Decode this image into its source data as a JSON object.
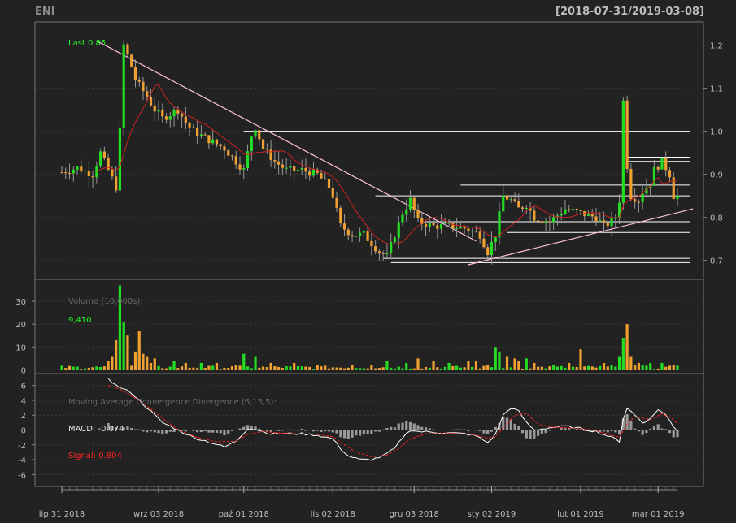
{
  "header": {
    "symbol": "ENI",
    "range": "[2018-07-31/2019-03-08]"
  },
  "colors": {
    "background": "#222222",
    "panel_border": "#777777",
    "grid": "#3a3a3a",
    "text": "#bdbdbd",
    "up": "#22dd22",
    "down": "#f0a030",
    "wick": "#999999",
    "ma": "#cc2222",
    "hline": "#ffffff",
    "trendline": "#ffc0e0",
    "macd_line": "#ffffff",
    "signal_line": "#ff2222",
    "histogram": "#999999",
    "last_label": "#22ff22",
    "signal_label": "#ff2222"
  },
  "chart_data": [
    {
      "type": "candlestick",
      "panel": "price",
      "label": "Last 0.85",
      "ylim": [
        0.68,
        1.23
      ],
      "yticks": [
        0.7,
        0.8,
        0.9,
        1.0,
        1.1,
        1.2
      ],
      "ytick_labels": [
        "0.7",
        "0.8",
        "0.9",
        "1.0",
        "1.1",
        "1.2"
      ],
      "xticks": [
        {
          "index": 0,
          "label": "lip 31 2018"
        },
        {
          "index": 25,
          "label": "wrz 03 2018"
        },
        {
          "index": 47,
          "label": "paź 01 2018"
        },
        {
          "index": 70,
          "label": "lis 02 2018"
        },
        {
          "index": 91,
          "label": "gru 03 2018"
        },
        {
          "index": 111,
          "label": "sty 02 2019"
        },
        {
          "index": 134,
          "label": "lut 01 2019"
        },
        {
          "index": 154,
          "label": "mar 01 2019"
        }
      ],
      "n_bars": 160,
      "anchors": [
        [
          0,
          0.905
        ],
        [
          4,
          0.915
        ],
        [
          8,
          0.9
        ],
        [
          10,
          0.95
        ],
        [
          12,
          0.91
        ],
        [
          14,
          0.87
        ],
        [
          15,
          1.0
        ],
        [
          16,
          1.2
        ],
        [
          18,
          1.15
        ],
        [
          19,
          1.12
        ],
        [
          22,
          1.08
        ],
        [
          24,
          1.05
        ],
        [
          26,
          1.03
        ],
        [
          30,
          1.05
        ],
        [
          32,
          1.02
        ],
        [
          34,
          1.0
        ],
        [
          38,
          0.98
        ],
        [
          42,
          0.96
        ],
        [
          45,
          0.93
        ],
        [
          47,
          0.91
        ],
        [
          49,
          0.99
        ],
        [
          50,
          1.01
        ],
        [
          52,
          0.96
        ],
        [
          55,
          0.93
        ],
        [
          58,
          0.91
        ],
        [
          62,
          0.91
        ],
        [
          66,
          0.9
        ],
        [
          69,
          0.87
        ],
        [
          70,
          0.85
        ],
        [
          72,
          0.78
        ],
        [
          75,
          0.76
        ],
        [
          78,
          0.76
        ],
        [
          80,
          0.74
        ],
        [
          82,
          0.72
        ],
        [
          84,
          0.71
        ],
        [
          86,
          0.76
        ],
        [
          88,
          0.81
        ],
        [
          90,
          0.84
        ],
        [
          92,
          0.79
        ],
        [
          96,
          0.78
        ],
        [
          100,
          0.78
        ],
        [
          104,
          0.775
        ],
        [
          108,
          0.76
        ],
        [
          110,
          0.72
        ],
        [
          111,
          0.74
        ],
        [
          112,
          0.76
        ],
        [
          114,
          0.85
        ],
        [
          116,
          0.84
        ],
        [
          118,
          0.82
        ],
        [
          120,
          0.83
        ],
        [
          122,
          0.8
        ],
        [
          126,
          0.79
        ],
        [
          130,
          0.82
        ],
        [
          134,
          0.81
        ],
        [
          138,
          0.8
        ],
        [
          140,
          0.78
        ],
        [
          142,
          0.79
        ],
        [
          143,
          0.8
        ],
        [
          144,
          0.84
        ],
        [
          145,
          1.07
        ],
        [
          146,
          0.92
        ],
        [
          147,
          0.85
        ],
        [
          149,
          0.84
        ],
        [
          150,
          0.86
        ],
        [
          152,
          0.88
        ],
        [
          153,
          0.91
        ],
        [
          155,
          0.93
        ],
        [
          157,
          0.9
        ],
        [
          158,
          0.85
        ],
        [
          159,
          0.85
        ]
      ],
      "horizontal_levels": [
        {
          "value": 1.0,
          "from_index": 47,
          "to_index": 159
        },
        {
          "value": 0.94,
          "from_index": 146,
          "to_index": 159
        },
        {
          "value": 0.93,
          "from_index": 146,
          "to_index": 159
        },
        {
          "value": 0.875,
          "from_index": 103,
          "to_index": 159
        },
        {
          "value": 0.85,
          "from_index": 81,
          "to_index": 159
        },
        {
          "value": 0.79,
          "from_index": 93,
          "to_index": 159
        },
        {
          "value": 0.765,
          "from_index": 115,
          "to_index": 159
        },
        {
          "value": 0.705,
          "from_index": 83,
          "to_index": 159
        },
        {
          "value": 0.695,
          "from_index": 85,
          "to_index": 159
        }
      ],
      "trendlines": [
        {
          "from": [
            9,
            1.21
          ],
          "to": [
            107,
            0.745
          ]
        },
        {
          "from": [
            105,
            0.69
          ],
          "to": [
            163,
            0.82
          ]
        }
      ]
    },
    {
      "type": "bar",
      "panel": "volume",
      "label": "Volume (10,000s):",
      "last_value_label": "9,410",
      "ylim": [
        0,
        38
      ],
      "yticks": [
        0,
        10,
        20,
        30
      ],
      "ytick_labels": [
        "0",
        "10",
        "20",
        "30"
      ],
      "spikes": [
        [
          12,
          4
        ],
        [
          13,
          6
        ],
        [
          14,
          13
        ],
        [
          15,
          37
        ],
        [
          16,
          21
        ],
        [
          17,
          15
        ],
        [
          19,
          8
        ],
        [
          20,
          17
        ],
        [
          21,
          7
        ],
        [
          22,
          6
        ],
        [
          23,
          3
        ],
        [
          24,
          5
        ],
        [
          29,
          4
        ],
        [
          32,
          3
        ],
        [
          36,
          3
        ],
        [
          40,
          3
        ],
        [
          45,
          2
        ],
        [
          47,
          7
        ],
        [
          50,
          6
        ],
        [
          54,
          3
        ],
        [
          60,
          3
        ],
        [
          66,
          2
        ],
        [
          75,
          2
        ],
        [
          80,
          2
        ],
        [
          84,
          4
        ],
        [
          89,
          3
        ],
        [
          92,
          5
        ],
        [
          96,
          4
        ],
        [
          100,
          3
        ],
        [
          105,
          4
        ],
        [
          107,
          4
        ],
        [
          110,
          2
        ],
        [
          112,
          10
        ],
        [
          113,
          8
        ],
        [
          115,
          6
        ],
        [
          117,
          5
        ],
        [
          118,
          4
        ],
        [
          120,
          5
        ],
        [
          122,
          3
        ],
        [
          127,
          2
        ],
        [
          131,
          3
        ],
        [
          134,
          9
        ],
        [
          140,
          3
        ],
        [
          142,
          2
        ],
        [
          144,
          6
        ],
        [
          145,
          14
        ],
        [
          146,
          20
        ],
        [
          147,
          6
        ],
        [
          148,
          2
        ],
        [
          149,
          3
        ],
        [
          150,
          2
        ],
        [
          152,
          3
        ],
        [
          155,
          3
        ],
        [
          158,
          2
        ]
      ]
    },
    {
      "type": "line",
      "panel": "macd",
      "label": "Moving Average Convergence Divergence (6,13,5):",
      "macd_label": "MACD: -0.074",
      "signal_label": "Signal: 0.804",
      "ylim": [
        -7,
        7
      ],
      "yticks": [
        -6,
        -4,
        -2,
        0,
        2,
        4,
        6
      ],
      "ytick_labels": [
        "-6",
        "-4",
        "-2",
        "0",
        "2",
        "4",
        "6"
      ],
      "series": [
        {
          "name": "MACD: -0.074",
          "values": [
            [
              12,
              7
            ],
            [
              14,
              6
            ],
            [
              18,
              5
            ],
            [
              22,
              3
            ],
            [
              26,
              1
            ],
            [
              30,
              0
            ],
            [
              34,
              -1
            ],
            [
              38,
              -1.6
            ],
            [
              42,
              -2.3
            ],
            [
              45,
              -1.5
            ],
            [
              48,
              0.2
            ],
            [
              50,
              0.1
            ],
            [
              54,
              -0.5
            ],
            [
              58,
              -0.5
            ],
            [
              62,
              -0.5
            ],
            [
              66,
              -0.7
            ],
            [
              70,
              -1.2
            ],
            [
              72,
              -2.5
            ],
            [
              74,
              -3.5
            ],
            [
              77,
              -4
            ],
            [
              80,
              -4
            ],
            [
              83,
              -3.5
            ],
            [
              86,
              -2.5
            ],
            [
              88,
              -1
            ],
            [
              90,
              0
            ],
            [
              92,
              -0.2
            ],
            [
              96,
              -0.3
            ],
            [
              100,
              -0.4
            ],
            [
              104,
              -0.5
            ],
            [
              107,
              -0.8
            ],
            [
              110,
              -1.7
            ],
            [
              112,
              -0.6
            ],
            [
              114,
              2
            ],
            [
              116,
              3
            ],
            [
              118,
              2.5
            ],
            [
              120,
              1
            ],
            [
              122,
              0
            ],
            [
              126,
              0.3
            ],
            [
              130,
              0.5
            ],
            [
              134,
              0.2
            ],
            [
              138,
              -0.2
            ],
            [
              142,
              -1
            ],
            [
              144,
              -1.5
            ],
            [
              145,
              1.5
            ],
            [
              146,
              3
            ],
            [
              148,
              2
            ],
            [
              150,
              1
            ],
            [
              152,
              1.5
            ],
            [
              154,
              2.8
            ],
            [
              156,
              2
            ],
            [
              158,
              0.5
            ],
            [
              159,
              -0.07
            ]
          ]
        },
        {
          "name": "Signal: 0.804",
          "values": [
            [
              12,
              6
            ],
            [
              15,
              5.5
            ],
            [
              20,
              4
            ],
            [
              25,
              2
            ],
            [
              30,
              0
            ],
            [
              35,
              -1
            ],
            [
              40,
              -1.6
            ],
            [
              45,
              -1.5
            ],
            [
              48,
              -0.6
            ],
            [
              52,
              -0.2
            ],
            [
              56,
              -0.4
            ],
            [
              60,
              -0.5
            ],
            [
              66,
              -0.6
            ],
            [
              70,
              -0.9
            ],
            [
              73,
              -2
            ],
            [
              76,
              -3
            ],
            [
              80,
              -3.6
            ],
            [
              84,
              -3.4
            ],
            [
              87,
              -2.5
            ],
            [
              90,
              -1.2
            ],
            [
              94,
              -0.5
            ],
            [
              100,
              -0.4
            ],
            [
              106,
              -0.6
            ],
            [
              110,
              -1.1
            ],
            [
              112,
              -0.9
            ],
            [
              114,
              0.3
            ],
            [
              117,
              2
            ],
            [
              120,
              2.2
            ],
            [
              123,
              0.8
            ],
            [
              126,
              0.4
            ],
            [
              130,
              0.3
            ],
            [
              134,
              0.2
            ],
            [
              138,
              -0.1
            ],
            [
              142,
              -0.7
            ],
            [
              144,
              -1
            ],
            [
              146,
              0.8
            ],
            [
              148,
              1.8
            ],
            [
              150,
              1.6
            ],
            [
              152,
              1.4
            ],
            [
              155,
              2.2
            ],
            [
              158,
              1.4
            ],
            [
              159,
              0.8
            ]
          ]
        }
      ]
    }
  ]
}
